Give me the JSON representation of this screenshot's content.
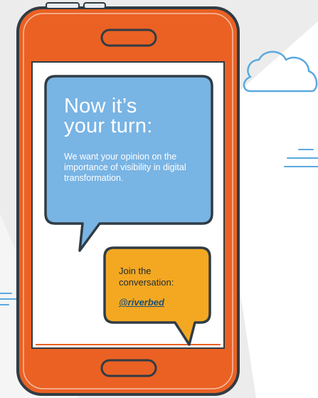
{
  "colors": {
    "phone_body": "#ea6123",
    "phone_outline": "#303c44",
    "screen": "#ffffff",
    "blue_bubble": "#78b4e4",
    "orange_bubble": "#f4a822",
    "background_shape": "#ececec",
    "cloud_outline": "#5aa9df"
  },
  "icons": {
    "cloud": "cloud-icon",
    "speaker": "speaker-slot-icon",
    "home_button": "home-button-icon"
  },
  "bubble_main": {
    "heading_line1": "Now it’s",
    "heading_line2": "your turn:",
    "body": "We want your opinion on the importance of visibility in digital transformation."
  },
  "bubble_cta": {
    "line1": "Join the",
    "line2": "conversation:",
    "handle": "@riverbed"
  }
}
